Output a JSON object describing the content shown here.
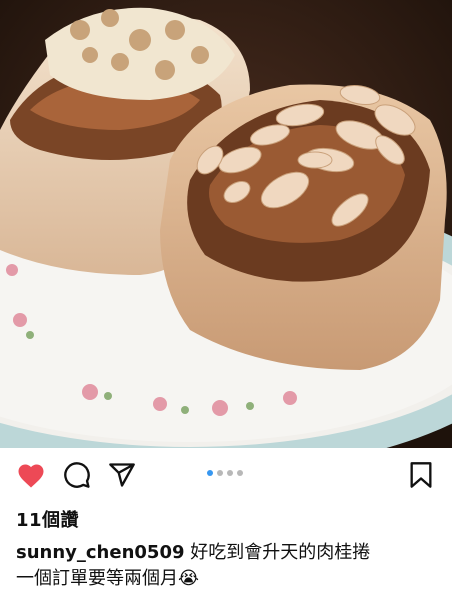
{
  "post": {
    "image_alt": "cinnamon rolls on floral plate",
    "carousel": {
      "total": 4,
      "active": 0
    },
    "likes_text": "11個讚",
    "username": "sunny_chen0509",
    "caption_line1": " 好吃到會升天的肉桂捲",
    "caption_line2": "一個訂單要等兩個月",
    "caption_emoji": "😭"
  },
  "actions": {
    "like_icon": "heart-icon",
    "comment_icon": "comment-icon",
    "share_icon": "share-icon",
    "save_icon": "bookmark-icon"
  },
  "colors": {
    "heart": "#ed4956",
    "carousel_active": "#3797f0",
    "carousel_inactive": "#b8b8b8"
  }
}
